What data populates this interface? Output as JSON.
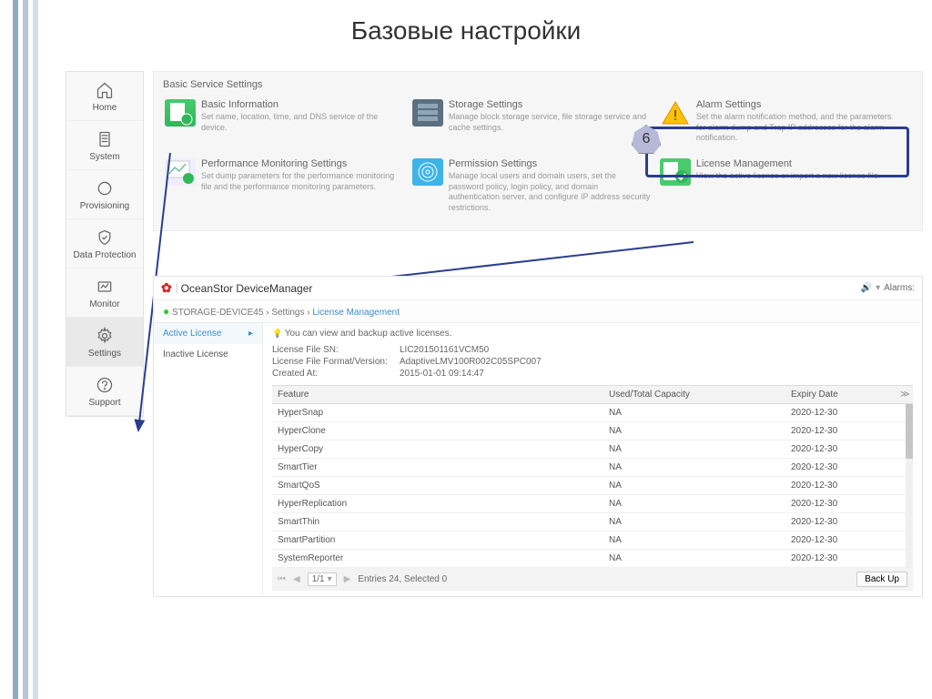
{
  "slide_title": "Базовые настройки",
  "sidebar": {
    "items": [
      {
        "label": "Home"
      },
      {
        "label": "System"
      },
      {
        "label": "Provisioning"
      },
      {
        "label": "Data Protection"
      },
      {
        "label": "Monitor"
      },
      {
        "label": "Settings"
      },
      {
        "label": "Support"
      }
    ]
  },
  "top_panel": {
    "title": "Basic Service Settings",
    "cards": [
      {
        "title": "Basic Information",
        "desc": "Set name, location, time, and DNS service of the device."
      },
      {
        "title": "Storage Settings",
        "desc": "Manage block storage service, file storage service and cache settings."
      },
      {
        "title": "Alarm Settings",
        "desc": "Set the alarm notification method, and the parameters for alarm dump and Trap IP addresses for the alarm notification."
      },
      {
        "title": "Performance Monitoring Settings",
        "desc": "Set dump parameters for the performance monitoring file and the performance monitoring parameters."
      },
      {
        "title": "Permission Settings",
        "desc": "Manage local users and domain users, set the password policy, login policy, and domain authentication server, and configure IP address security restrictions."
      },
      {
        "title": "License Management",
        "desc": "View the active license or import a new license file."
      }
    ]
  },
  "step_number": "6",
  "bottom_panel": {
    "product": "OceanStor DeviceManager",
    "alarms_label": "Alarms:",
    "breadcrumb": {
      "device": "STORAGE-DEVICE45",
      "sec": "Settings",
      "page": "License Management"
    },
    "side": {
      "active": "Active License",
      "inactive": "Inactive License"
    },
    "info": "You can view and backup active licenses.",
    "meta": [
      {
        "k": "License File SN:",
        "v": "LIC201501161VCM50"
      },
      {
        "k": "License File Format/Version:",
        "v": "AdaptiveLMV100R002C05SPC007"
      },
      {
        "k": "Created At:",
        "v": "2015-01-01 09:14:47"
      }
    ],
    "columns": {
      "feature": "Feature",
      "capacity": "Used/Total Capacity",
      "expiry": "Expiry Date"
    },
    "rows": [
      {
        "f": "HyperSnap",
        "c": "NA",
        "e": "2020-12-30"
      },
      {
        "f": "HyperClone",
        "c": "NA",
        "e": "2020-12-30"
      },
      {
        "f": "HyperCopy",
        "c": "NA",
        "e": "2020-12-30"
      },
      {
        "f": "SmartTier",
        "c": "NA",
        "e": "2020-12-30"
      },
      {
        "f": "SmartQoS",
        "c": "NA",
        "e": "2020-12-30"
      },
      {
        "f": "HyperReplication",
        "c": "NA",
        "e": "2020-12-30"
      },
      {
        "f": "SmartThin",
        "c": "NA",
        "e": "2020-12-30"
      },
      {
        "f": "SmartPartition",
        "c": "NA",
        "e": "2020-12-30"
      },
      {
        "f": "SystemReporter",
        "c": "NA",
        "e": "2020-12-30"
      }
    ],
    "pager": "1/1",
    "footer_text": "Entries 24, Selected 0",
    "backup": "Back Up"
  }
}
